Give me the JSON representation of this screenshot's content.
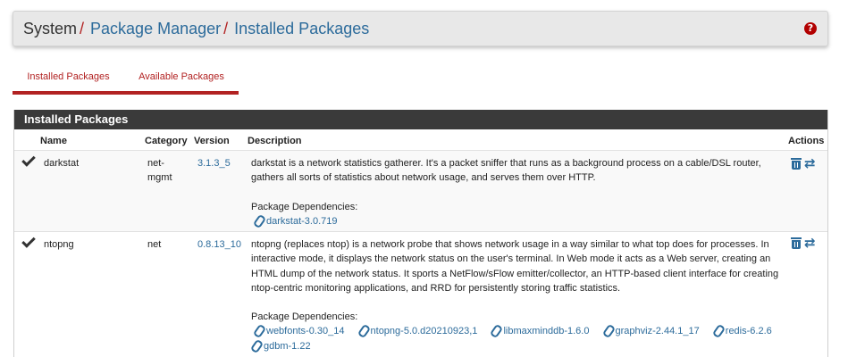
{
  "breadcrumb": {
    "system": "System",
    "package_manager": "Package Manager",
    "installed_packages": "Installed Packages",
    "separator": "/"
  },
  "tabs": [
    {
      "label": "Installed Packages",
      "active": true
    },
    {
      "label": "Available Packages",
      "active": false
    }
  ],
  "panel": {
    "title": "Installed Packages",
    "columns": {
      "name": "Name",
      "category": "Category",
      "version": "Version",
      "description": "Description",
      "actions": "Actions"
    },
    "rows": [
      {
        "name": "darkstat",
        "category": "net-mgmt",
        "version": "3.1.3_5",
        "description": "darkstat is a network statistics gatherer. It's a packet sniffer that runs as a background process on a cable/DSL router, gathers all sorts of statistics about network usage, and serves them over HTTP.",
        "deps_label": "Package Dependencies:",
        "deps": [
          "darkstat-3.0.719"
        ]
      },
      {
        "name": "ntopng",
        "category": "net",
        "version": "0.8.13_10",
        "description": "ntopng (replaces ntop) is a network probe that shows network usage in a way similar to what top does for processes. In interactive mode, it displays the network status on the user's terminal. In Web mode it acts as a Web server, creating an HTML dump of the network status. It sports a NetFlow/sFlow emitter/collector, an HTTP-based client interface for creating ntop-centric monitoring applications, and RRD for persistently storing traffic statistics.",
        "deps_label": "Package Dependencies:",
        "deps": [
          "webfonts-0.30_14",
          "ntopng-5.0.d20210923,1",
          "libmaxminddb-1.6.0",
          "graphviz-2.44.1_17",
          "redis-6.2.6",
          "gdbm-1.22"
        ]
      }
    ]
  },
  "icons": {
    "help": "question-circle-icon",
    "installed": "check-icon",
    "dependency": "paperclip-icon",
    "remove": "trash-icon",
    "reinstall": "retweet-icon"
  },
  "colors": {
    "accent_red": "#b22222",
    "link_blue": "#2c6b9b",
    "panel_header": "#3a3a3a"
  }
}
